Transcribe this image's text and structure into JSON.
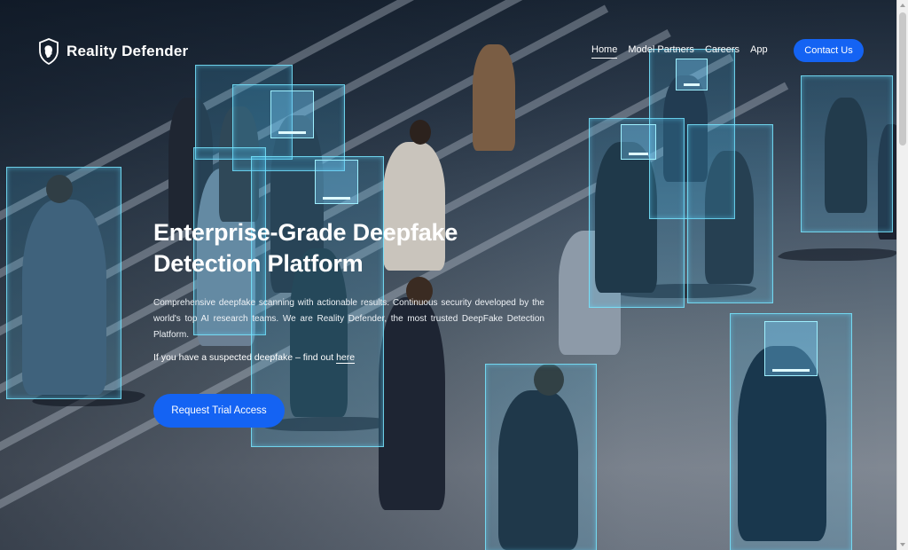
{
  "brand": {
    "name": "Reality Defender",
    "icon": "shield-face-icon"
  },
  "nav": {
    "items": [
      {
        "label": "Home",
        "active": true
      },
      {
        "label": "Model Partners",
        "active": false
      },
      {
        "label": "Careers",
        "active": false
      },
      {
        "label": "App",
        "active": false
      }
    ],
    "contact_label": "Contact Us"
  },
  "hero": {
    "title_line1": "Enterprise-Grade Deepfake",
    "title_line2": "Detection Platform",
    "description": "Comprehensive deepfake scanning with actionable results. Continuous security developed by the world's top AI research teams. We are Reality Defender, the most trusted DeepFake Detection Platform.",
    "prompt_text": "If you have a suspected deepfake – find out ",
    "prompt_link": "here",
    "cta_label": "Request Trial Access"
  },
  "colors": {
    "accent": "#1463f3",
    "scan_box": "#78e6ff"
  }
}
